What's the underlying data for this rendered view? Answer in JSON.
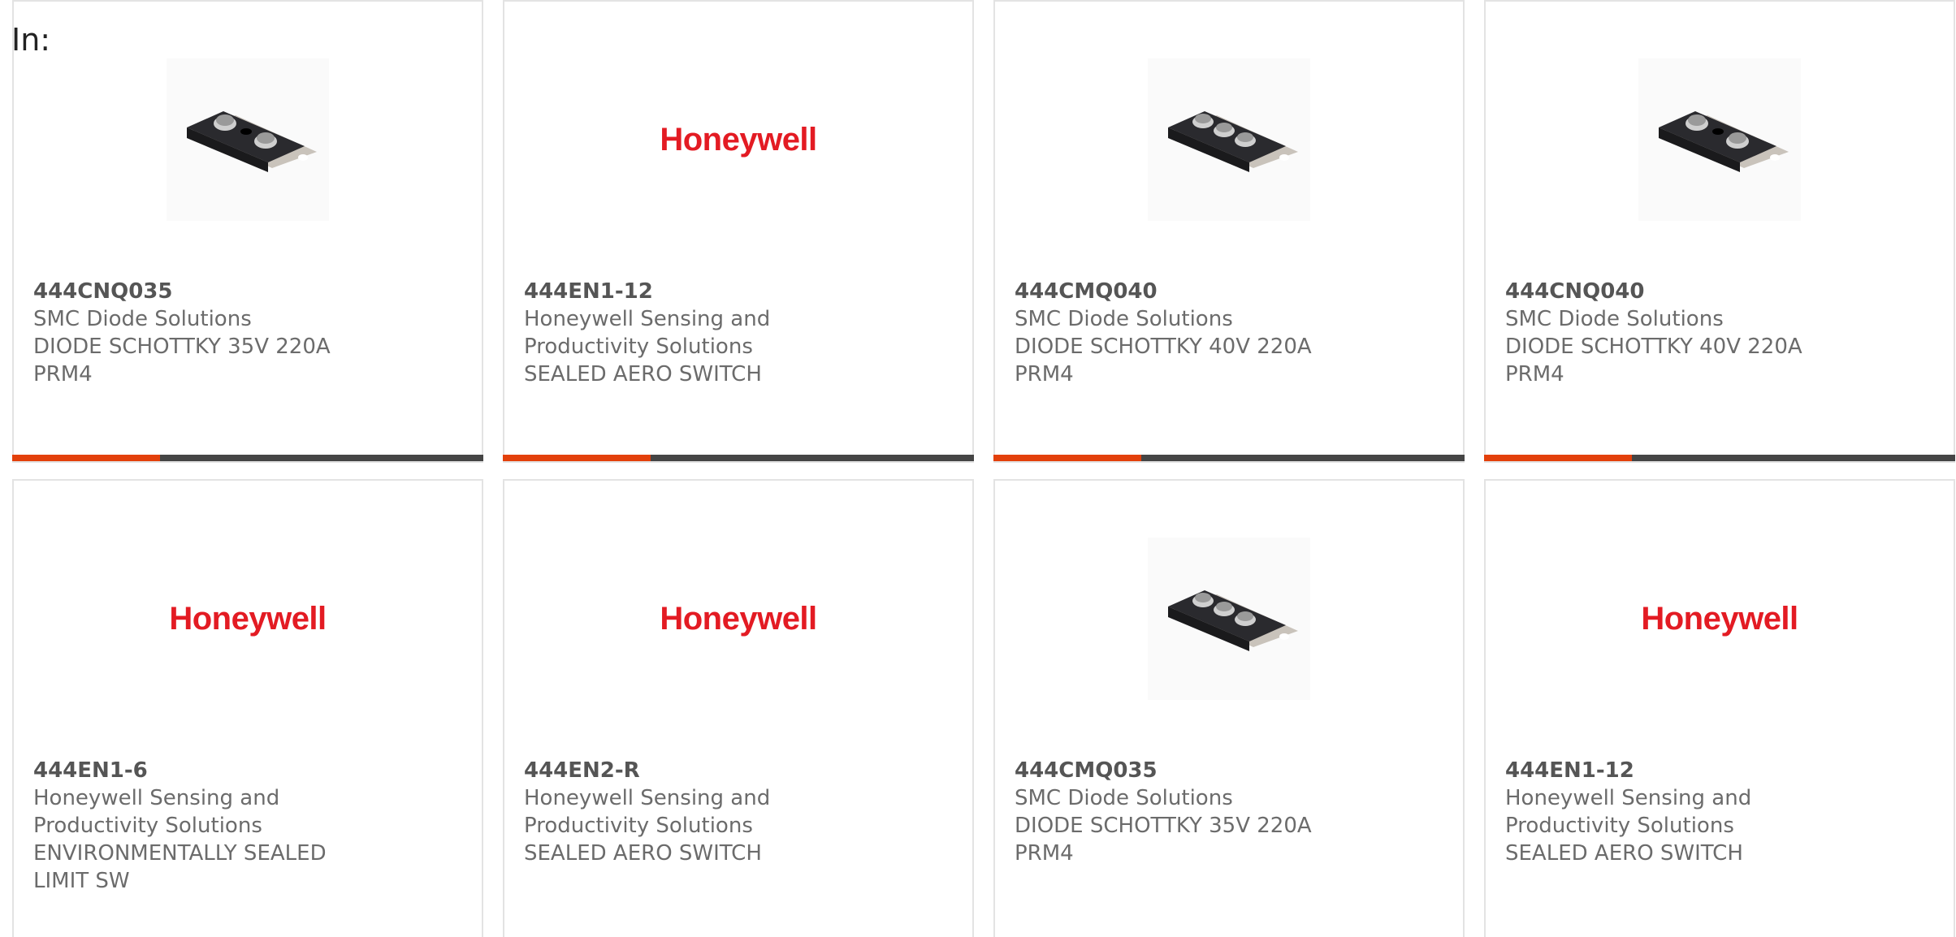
{
  "filter_label": "In:",
  "colors": {
    "accent": "#e3400b",
    "bar_dark": "#454545",
    "brand_red": "#e31b23",
    "text": "#6b6b6b"
  },
  "products": [
    {
      "image": "diode-two-terminal-photo",
      "part": "444CNQ035",
      "manufacturer": "SMC Diode Solutions",
      "description_lines": [
        "DIODE SCHOTTKY 35V 220A",
        "PRM4"
      ]
    },
    {
      "image": "honeywell-logo",
      "logo_text": "Honeywell",
      "part": "444EN1-12",
      "manufacturer": "Honeywell Sensing and",
      "description_lines": [
        "Productivity Solutions",
        "SEALED AERO SWITCH"
      ]
    },
    {
      "image": "diode-three-terminal-photo",
      "part": "444CMQ040",
      "manufacturer": "SMC Diode Solutions",
      "description_lines": [
        "DIODE SCHOTTKY 40V 220A",
        "PRM4"
      ]
    },
    {
      "image": "diode-two-terminal-photo",
      "part": "444CNQ040",
      "manufacturer": "SMC Diode Solutions",
      "description_lines": [
        "DIODE SCHOTTKY 40V 220A",
        "PRM4"
      ]
    },
    {
      "image": "honeywell-logo",
      "logo_text": "Honeywell",
      "part": "444EN1-6",
      "manufacturer": "Honeywell Sensing and",
      "description_lines": [
        "Productivity Solutions",
        "ENVIRONMENTALLY SEALED",
        "LIMIT SW"
      ]
    },
    {
      "image": "honeywell-logo",
      "logo_text": "Honeywell",
      "part": "444EN2-R",
      "manufacturer": "Honeywell Sensing and",
      "description_lines": [
        "Productivity Solutions",
        "SEALED AERO SWITCH"
      ]
    },
    {
      "image": "diode-three-terminal-photo",
      "part": "444CMQ035",
      "manufacturer": "SMC Diode Solutions",
      "description_lines": [
        "DIODE SCHOTTKY 35V 220A",
        "PRM4"
      ]
    },
    {
      "image": "honeywell-logo",
      "logo_text": "Honeywell",
      "part": "444EN1-12",
      "manufacturer": "Honeywell Sensing and",
      "description_lines": [
        "Productivity Solutions",
        "SEALED AERO SWITCH"
      ]
    }
  ]
}
